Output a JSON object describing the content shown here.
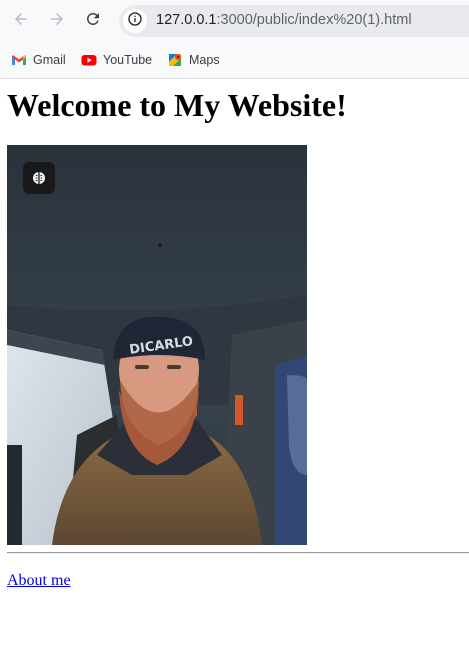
{
  "browser": {
    "url_host": "127.0.0.1",
    "url_path": ":3000/public/index%20(1).html",
    "nav": {
      "back_icon": "arrow-left-icon",
      "forward_icon": "arrow-right-icon",
      "reload_icon": "reload-icon",
      "site_info_icon": "info-circle-icon"
    },
    "bookmarks": [
      {
        "label": "Gmail",
        "icon": "gmail-icon"
      },
      {
        "label": "YouTube",
        "icon": "youtube-icon"
      },
      {
        "label": "Maps",
        "icon": "maps-icon"
      }
    ]
  },
  "page": {
    "heading": "Welcome to My Website!",
    "image": {
      "alt_description_icon": "photo-selfie",
      "overlay_icon": "google-lens-icon"
    },
    "link": "About me"
  }
}
